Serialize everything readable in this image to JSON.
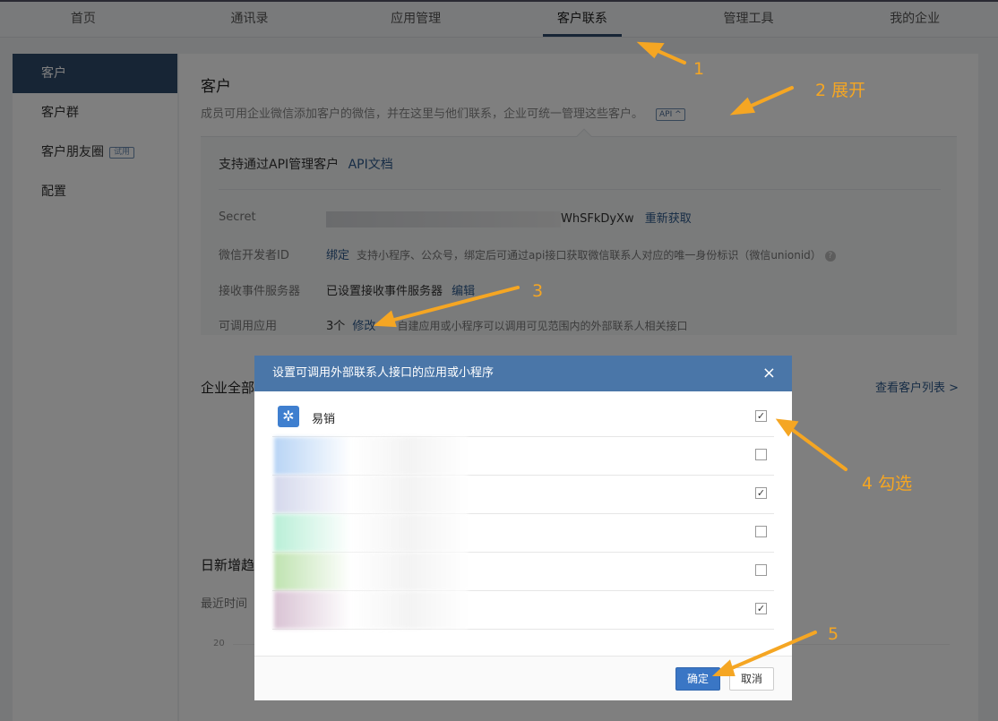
{
  "topnav": {
    "items": [
      "首页",
      "通讯录",
      "应用管理",
      "客户联系",
      "管理工具",
      "我的企业"
    ],
    "active_index": 3
  },
  "sidebar": {
    "items": [
      {
        "label": "客户"
      },
      {
        "label": "客户群"
      },
      {
        "label": "客户朋友圈",
        "badge": "试用"
      },
      {
        "label": "配置"
      }
    ]
  },
  "main": {
    "title": "客户",
    "desc": "成员可用企业微信添加客户的微信，并在这里与他们联系，企业可统一管理这些客户。",
    "api_badge": "API ^",
    "api_panel": {
      "head": "支持通过API管理客户",
      "head_link": "API文档",
      "secret_label": "Secret",
      "secret_tail": "WhSFkDyXw",
      "secret_action": "重新获取",
      "wechat_dev_label": "微信开发者ID",
      "wechat_dev_link": "绑定",
      "wechat_dev_hint": "支持小程序、公众号，绑定后可通过api接口获取微信联系人对应的唯一身份标识（微信unionid）",
      "event_server_label": "接收事件服务器",
      "event_server_value": "已设置接收事件服务器",
      "event_server_link": "编辑",
      "callable_apps_label": "可调用应用",
      "callable_apps_count": "3个",
      "callable_apps_link": "修改",
      "callable_apps_hint": "自建应用或小程序可以调用可见范围内的外部联系人相关接口"
    },
    "section2_title": "企业全部",
    "view_list": "查看客户列表 >",
    "section3_title": "日新增趋",
    "recent_label": "最近时间",
    "axis_tick": "20"
  },
  "modal": {
    "title": "设置可调用外部联系人接口的应用或小程序",
    "close_icon": "×",
    "apps": [
      {
        "name": "易销",
        "checked": true,
        "icon": "octopus-icon"
      },
      {
        "name": "",
        "checked": false,
        "color": "#b8d4f5"
      },
      {
        "name": "",
        "checked": true,
        "color": "#d4d8ec"
      },
      {
        "name": "",
        "checked": false,
        "color": "#b9efd7"
      },
      {
        "name": "",
        "checked": false,
        "color": "#bfe3b0"
      },
      {
        "name": "",
        "checked": true,
        "color": "#d9c3d4"
      }
    ],
    "ok_label": "确定",
    "cancel_label": "取消"
  },
  "annotations": {
    "a1": "1",
    "a2": "2 展开",
    "a3": "3",
    "a4": "4 勾选",
    "a5": "5"
  },
  "colors": {
    "accent": "#2e4a6b",
    "modal_header": "#4a76a8",
    "annotation": "#f5a623"
  }
}
